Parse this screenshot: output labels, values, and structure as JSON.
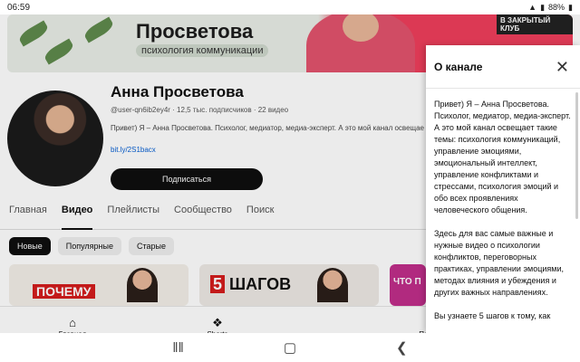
{
  "status": {
    "time": "06:59",
    "battery": "88%"
  },
  "banner": {
    "title": "Просветова",
    "subtitle": "психология коммуникации",
    "tag": "В ЗАКРЫТЫЙ КЛУБ"
  },
  "channel": {
    "name": "Анна Просветова",
    "handle": "@user-qn6ib2ey4r",
    "subscribers": "12,5 тыс. подписчиков",
    "videos": "22 видео",
    "description_preview": "Привет) Я – Анна Просветова. Психолог, медиатор, медиа-эксперт. А это мой канал освещае",
    "link": "bit.ly/2S1bacx",
    "subscribe_label": "Подписаться"
  },
  "tabs": [
    {
      "label": "Главная"
    },
    {
      "label": "Видео"
    },
    {
      "label": "Плейлисты"
    },
    {
      "label": "Сообщество"
    },
    {
      "label": "Поиск"
    }
  ],
  "chips": [
    {
      "label": "Новые"
    },
    {
      "label": "Популярные"
    },
    {
      "label": "Старые"
    }
  ],
  "thumbs": [
    {
      "label": "ПОЧЕМУ"
    },
    {
      "label_num": "5",
      "label": "ШАГОВ"
    },
    {
      "label": "ЧТО П"
    }
  ],
  "bottom_nav": [
    {
      "label": "Главная",
      "icon": "home-icon"
    },
    {
      "label": "Shorts",
      "icon": "shorts-icon"
    },
    {
      "label": "Подписки",
      "icon": "subscriptions-icon"
    }
  ],
  "about": {
    "title": "О канале",
    "paragraph1": "Привет) Я – Анна Просветова. Психолог, медиатор, медиа-эксперт. А это мой канал освещает такие темы: психология коммуникаций, управление эмоциями, эмоциональный интеллект, управление конфликтами и стрессами, психология эмоций и обо всех проявлениях человеческого общения.",
    "paragraph2": "Здесь для вас самые важные и нужные видео о психологии конфликтов, переговорных практиках, управлении эмоциями, методах влияния и убеждения и других важных направлениях.",
    "paragraph3": "Вы узнаете 5 шагов к тому, как"
  }
}
